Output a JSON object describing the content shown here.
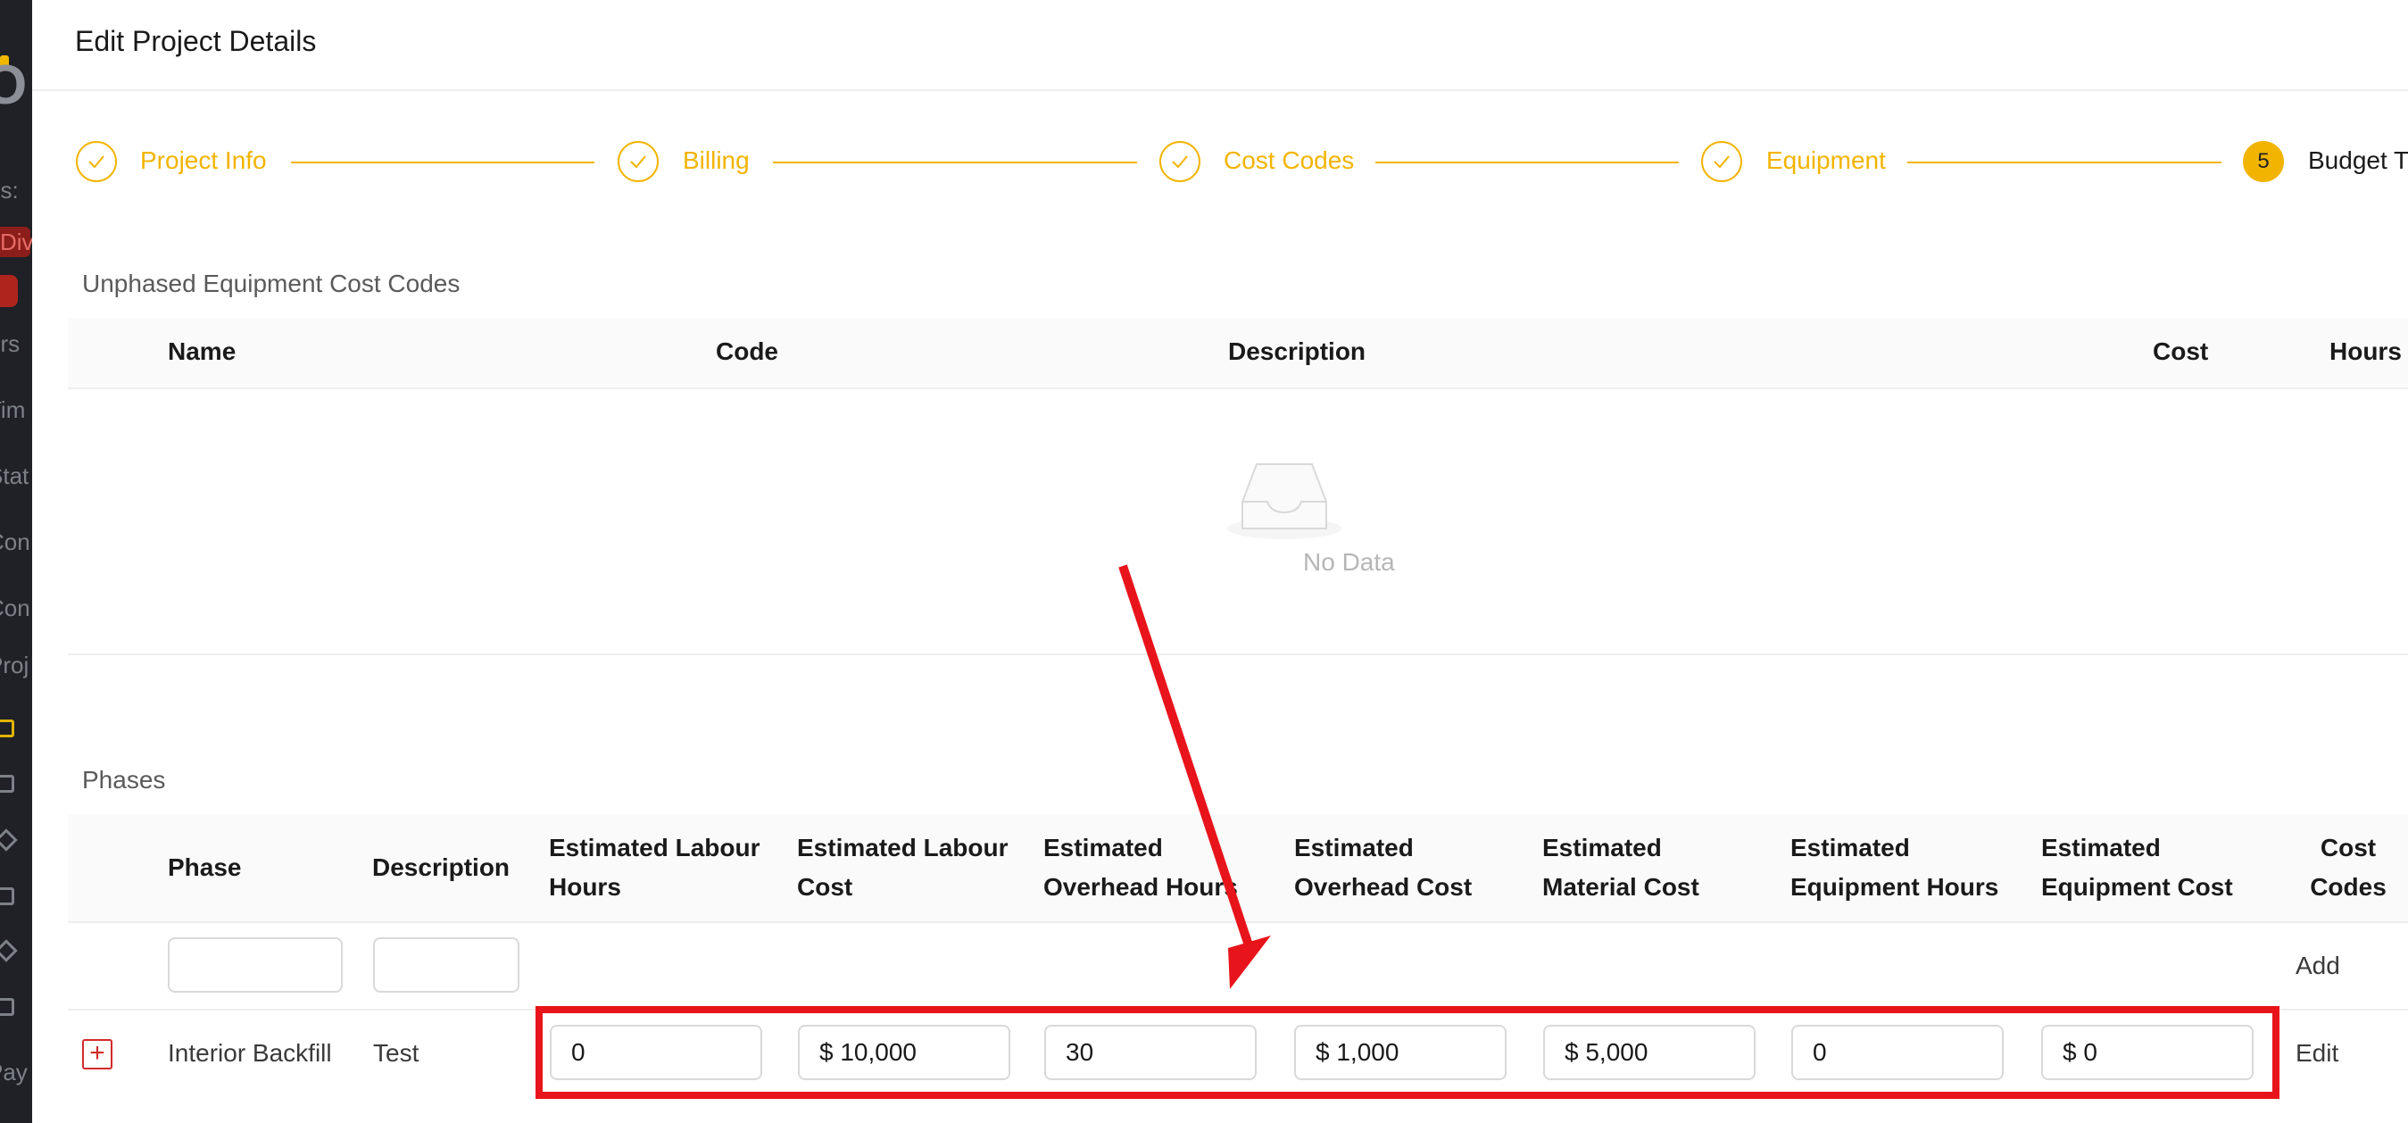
{
  "sidebar": {
    "logo_text": "O",
    "items": [
      "ns:",
      "Div",
      "ers",
      "Tim",
      "Stat",
      "Con",
      "Con",
      "Proj",
      "Pay"
    ]
  },
  "header": {
    "title": "Edit Project Details"
  },
  "steps": [
    {
      "label": "Project Info",
      "state": "done"
    },
    {
      "label": "Billing",
      "state": "done"
    },
    {
      "label": "Cost Codes",
      "state": "done"
    },
    {
      "label": "Equipment",
      "state": "done"
    },
    {
      "label": "Budget T",
      "number": "5",
      "state": "active"
    }
  ],
  "unphased": {
    "title": "Unphased Equipment Cost Codes",
    "columns": [
      "Name",
      "Code",
      "Description",
      "Cost",
      "Hours"
    ],
    "empty_text": "No Data"
  },
  "phases": {
    "title": "Phases",
    "columns": [
      "Phase",
      "Description",
      "Estimated Labour Hours",
      "Estimated Labour Cost",
      "Estimated Overhead Hours",
      "Estimated Overhead Cost",
      "Estimated Material Cost",
      "Estimated Equipment Hours",
      "Estimated Equipment Cost",
      "Cost Codes"
    ],
    "new_row": {
      "phase_value": "",
      "description_value": "",
      "action": "Add"
    },
    "rows": [
      {
        "phase": "Interior Backfill",
        "description": "Test",
        "labour_hours": "0",
        "labour_cost": "$ 10,000",
        "overhead_hours": "30",
        "overhead_cost": "$ 1,000",
        "material_cost": "$ 5,000",
        "equipment_hours": "0",
        "equipment_cost": "$ 0",
        "action": "Edit"
      }
    ]
  },
  "colors": {
    "accent": "#f2b400",
    "annotation": "#e8141b",
    "sidebar_bg": "#1f2126"
  }
}
